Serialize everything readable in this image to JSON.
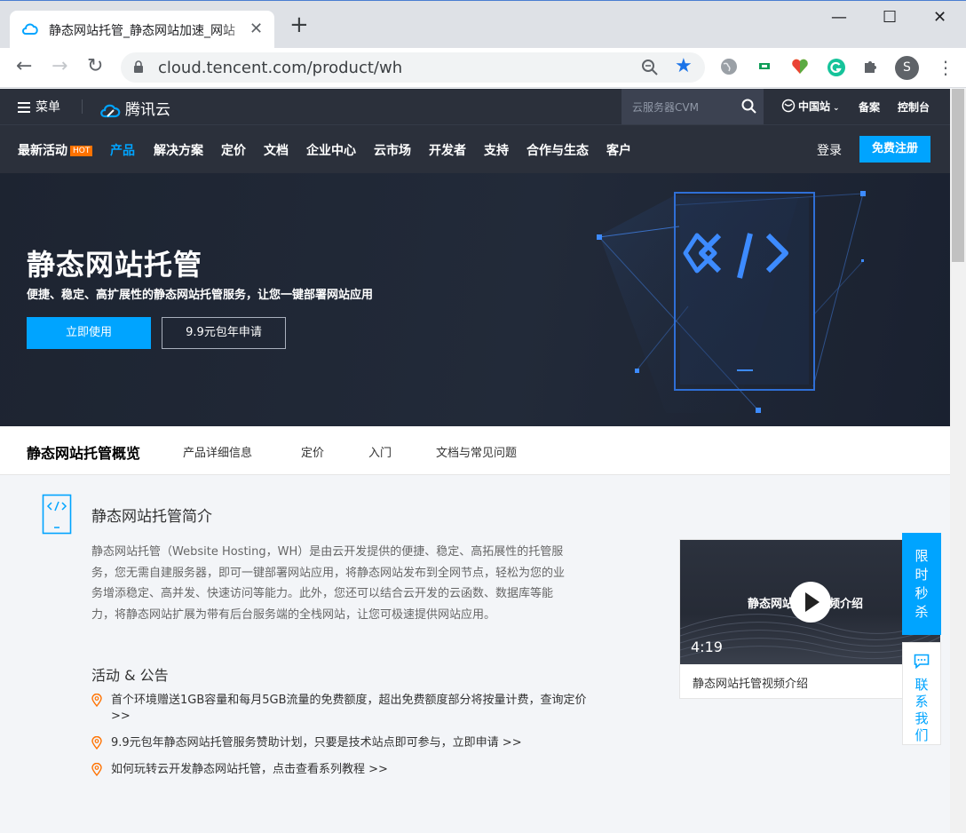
{
  "browser": {
    "tab_title": "静态网站托管_静态网站加速_网站",
    "tab_close": "✕",
    "new_tab": "+",
    "url": "cloud.tencent.com/product/wh",
    "profile_initial": "S",
    "window_minimize": "—",
    "window_maximize": "☐",
    "window_close": "✕"
  },
  "topbar": {
    "menu_label": "菜单",
    "logo_text": "腾讯云",
    "search_placeholder": "云服务器CVM",
    "region_label": "中国站",
    "links": [
      "备案",
      "控制台"
    ]
  },
  "mainnav": {
    "items": [
      "最新活动",
      "产品",
      "解决方案",
      "定价",
      "文档",
      "企业中心",
      "云市场",
      "开发者",
      "支持",
      "合作与生态",
      "客户"
    ],
    "hot_badge": "HOT",
    "active_index": 1,
    "login": "登录",
    "register": "免费注册"
  },
  "hero": {
    "title": "静态网站托管",
    "subtitle": "便捷、稳定、高扩展性的静态网站托管服务，让您一键部署网站应用",
    "primary_button": "立即使用",
    "secondary_button": "9.9元包年申请"
  },
  "subnav": {
    "title": "静态网站托管概览",
    "items": [
      "产品详细信息",
      "定价",
      "入门",
      "文档与常见问题"
    ]
  },
  "intro": {
    "title": "静态网站托管简介",
    "body": "静态网站托管（Website Hosting，WH）是由云开发提供的便捷、稳定、高拓展性的托管服务，您无需自建服务器，即可一键部署网站应用，将静态网站发布到全网节点，轻松为您的业务增添稳定、高并发、快速访问等能力。此外，您还可以结合云开发的云函数、数据库等能力，将静态网站扩展为带有后台服务端的全栈网站，让您可极速提供网站应用。"
  },
  "activities": {
    "title": "活动 & 公告",
    "items": [
      "首个环境赠送1GB容量和每月5GB流量的免费额度，超出免费额度部分将按量计费，查询定价 >>",
      "9.9元包年静态网站托管服务赞助计划，只要是技术站点即可参与，立即申请 >>",
      "如何玩转云开发静态网站托管，点击查看系列教程 >>"
    ]
  },
  "video": {
    "overlay_title": "静态网站托管视频介绍",
    "duration": "4:19",
    "caption": "静态网站托管视频介绍"
  },
  "float": {
    "sale": "限时秒杀",
    "contact": "联系我们"
  },
  "colors": {
    "accent": "#00a4ff",
    "header_bg": "#2b303b",
    "hot": "#ff7200"
  }
}
